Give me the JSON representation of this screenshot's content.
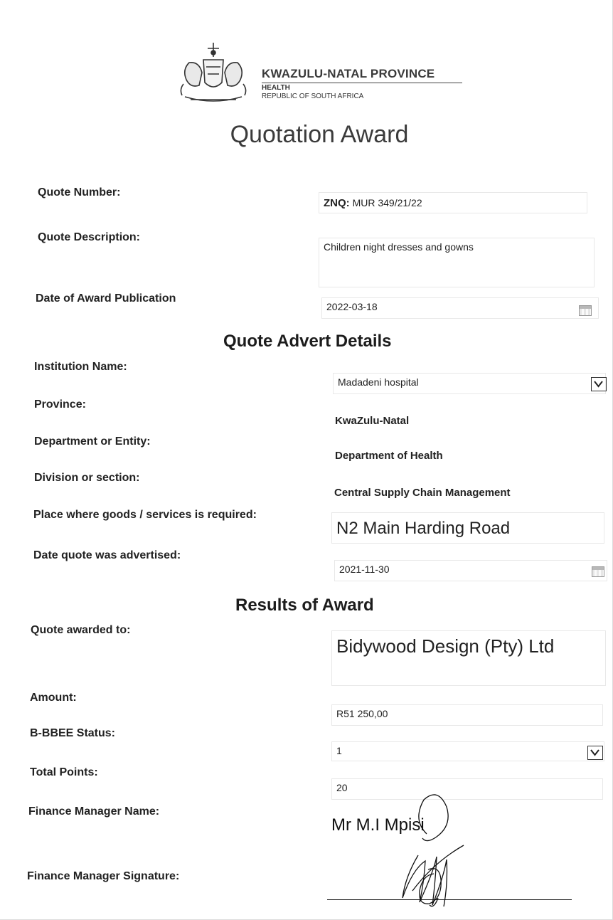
{
  "header": {
    "province": "KWAZULU-NATAL PROVINCE",
    "department": "HEALTH",
    "country": "REPUBLIC OF SOUTH AFRICA"
  },
  "title": "Quotation Award",
  "quote": {
    "number_label": "Quote Number:",
    "number_prefix": "ZNQ:",
    "number_value": "MUR 349/21/22",
    "description_label": "Quote Description:",
    "description_value": "Children night dresses and gowns",
    "publication_label": "Date of Award Publication",
    "publication_value": "2022-03-18"
  },
  "advert": {
    "heading": "Quote Advert Details",
    "institution_label": "Institution Name:",
    "institution_value": "Madadeni hospital",
    "province_label": "Province:",
    "province_value": "KwaZulu-Natal",
    "department_label": "Department or Entity:",
    "department_value": "Department of Health",
    "division_label": "Division or section:",
    "division_value": "Central Supply Chain Management",
    "place_label": "Place where goods /  services is required:",
    "place_value": "N2 Main Harding Road",
    "advertised_label": "Date quote was advertised:",
    "advertised_value": "2021-11-30"
  },
  "results": {
    "heading": "Results of Award",
    "awarded_label": "Quote awarded to:",
    "awarded_value": "Bidywood Design (Pty) Ltd",
    "amount_label": "Amount:",
    "amount_value": "R51 250,00",
    "bbbee_label": "B-BBEE Status:",
    "bbbee_value": "1",
    "points_label": "Total Points:",
    "points_value": "20",
    "manager_name_label": "Finance Manager Name:",
    "manager_name_value": "Mr M.I Mpisi",
    "manager_signature_label": "Finance Manager Signature:"
  },
  "icons": {
    "dropdown": "chevron-down-icon",
    "calendar": "calendar-icon",
    "crest": "coat-of-arms-icon"
  }
}
